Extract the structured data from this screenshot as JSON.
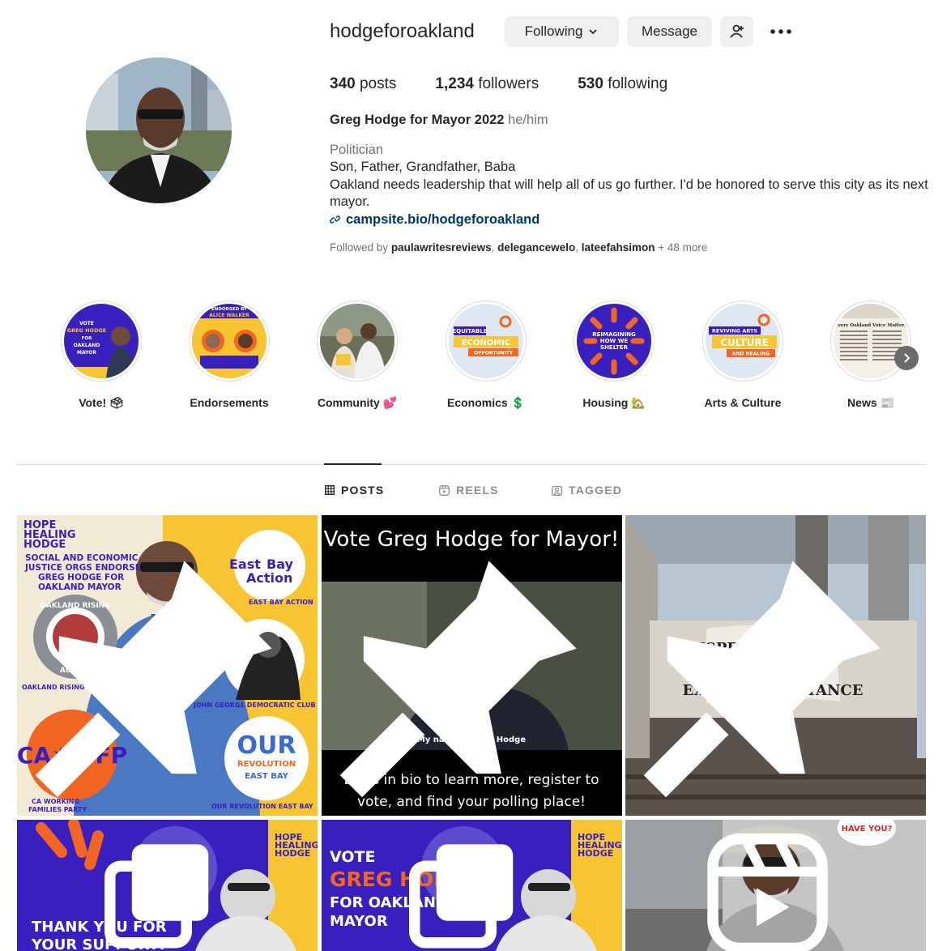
{
  "profile": {
    "username": "hodgeforoakland",
    "following_label": "Following",
    "message_label": "Message",
    "stats": {
      "posts_count": "340",
      "posts_label": "posts",
      "followers_count": "1,234",
      "followers_label": "followers",
      "following_count": "530",
      "following_label": "following"
    },
    "name": "Greg Hodge for Mayor 2022",
    "pronouns": "he/him",
    "category": "Politician",
    "bio_line1": "Son, Father, Grandfather, Baba",
    "bio_line2": "Oakland needs leadership that will help all of us go further. I'd be honored to serve this city as its next mayor.",
    "link": "campsite.bio/hodgeforoakland",
    "followed_by_prefix": "Followed by",
    "followed_by_1": "paulawritesreviews",
    "followed_by_2": "delegancewelo",
    "followed_by_3": "lateefahsimon",
    "followed_by_more": "+ 48 more"
  },
  "highlights": [
    {
      "label": "Vote! 🗳",
      "icon": "ballot-box"
    },
    {
      "label": "Endorsements",
      "icon": ""
    },
    {
      "label": "Community 💕",
      "icon": "two-hearts"
    },
    {
      "label": "Economics 💲",
      "icon": "dollar-sign"
    },
    {
      "label": "Housing 🏡",
      "icon": "house"
    },
    {
      "label": "Arts & Culture",
      "icon": ""
    },
    {
      "label": "News 📰",
      "icon": "newspaper"
    }
  ],
  "highlight_art": {
    "vote": [
      "VOTE",
      "GREG HODGE",
      "FOR",
      "OAKLAND",
      "MAYOR"
    ],
    "endorse": [
      "ENDORSED BY",
      "ALICE WALKER"
    ],
    "econ": [
      "EQUITABLE",
      "ECONOMIC",
      "OPPORTUNITY"
    ],
    "housing": [
      "REIMAGINING",
      "HOW WE",
      "SHELTER"
    ],
    "arts": [
      "REVIVING ARTS",
      "CULTURE",
      "AND HEALING"
    ],
    "news": "Every Oakland Voice Matters"
  },
  "tabs": {
    "posts": "POSTS",
    "reels": "REELS",
    "tagged": "TAGGED"
  },
  "posts": {
    "p1": {
      "brand": [
        "HOPE",
        "HEALING",
        "HODGE"
      ],
      "headline": [
        "SOCIAL AND ECONOMIC",
        "JUSTICE ORGS ENDORSE",
        "GREG HODGE FOR",
        "OAKLAND MAYOR"
      ],
      "eba": [
        "East",
        "Bay",
        "Action"
      ],
      "eba_caption": "EAST BAY ACTION",
      "ora_caption": "OAKLAND RISING ACTION",
      "ora_ring_top": "OAKLAND RISING",
      "ora_ring_bottom": "ACTION",
      "jgdc_caption": "JOHN GEORGE DEMOCRATIC CLUB",
      "wfp": "CA✶WFP",
      "wfp_caption": [
        "CA WORKING",
        "FAMILIES PARTY"
      ],
      "our_rev": [
        "OUR",
        "REVOLUTION",
        "EAST BAY"
      ],
      "our_rev_caption": "OUR REVOLUTION EAST BAY"
    },
    "p2": {
      "title": "Vote Greg Hodge for Mayor!",
      "subtitle": "My name is Greg Hodge",
      "caption_line1": "Links in bio to learn more, register to",
      "caption_line2": "vote, and find your polling place!"
    },
    "p3": {
      "banner": [
        "RESPECT EXISTENCE",
        "OR",
        "EXPECT RESISTANCE"
      ]
    },
    "p4": {
      "thanks": [
        "THANK YOU FOR",
        "YOUR SUPPORT!"
      ],
      "brand": [
        "HOPE",
        "HEALING",
        "HODGE"
      ]
    },
    "p5": {
      "lines": [
        "VOTE",
        "GREG HODGE",
        "FOR OAKLAND",
        "MAYOR"
      ],
      "brand": [
        "HOPE",
        "HEALING",
        "HODGE"
      ]
    },
    "p6": {
      "bubble": "HAVE YOU?"
    }
  },
  "colors": {
    "link": "#00376b",
    "button_bg": "#efefef",
    "purple": "#3a1fbf",
    "orange": "#f26522",
    "yellow": "#f7c531"
  }
}
